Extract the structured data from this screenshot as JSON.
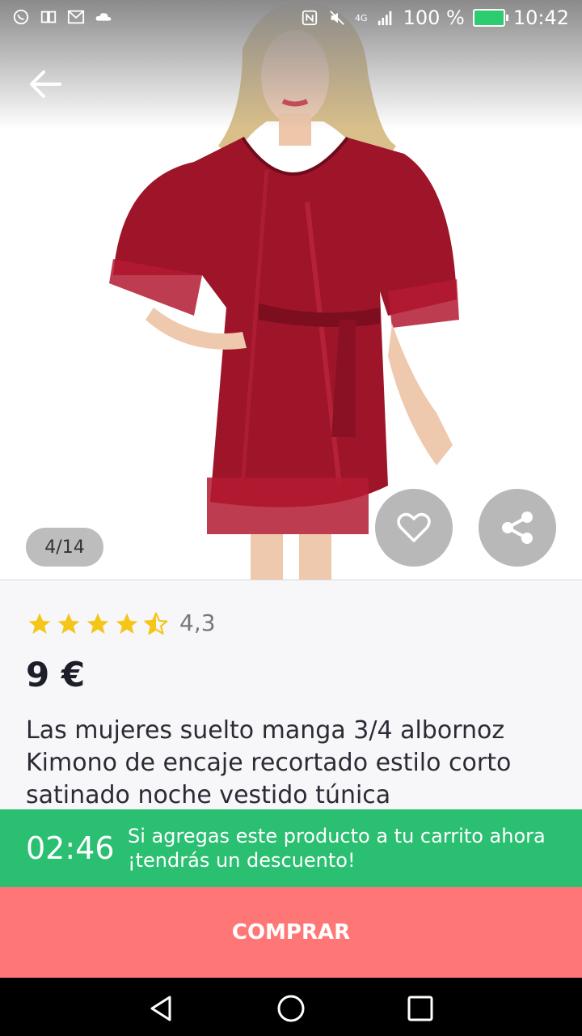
{
  "status_bar": {
    "battery": "100 %",
    "time": "10:42",
    "network": "4G"
  },
  "gallery": {
    "counter": "4/14"
  },
  "product": {
    "rating": "4,3",
    "rating_value": 4.3,
    "price": "9 €",
    "title": "Las mujeres suelto manga 3/4 albornoz Kimono de encaje recortado estilo corto satinado noche vestido túnica"
  },
  "promo": {
    "timer": "02:46",
    "message": "Si agregas este producto a tu carrito ahora ¡tendrás un descuento!"
  },
  "buy_button": {
    "label": "COMPRAR"
  },
  "colors": {
    "promo": "#2bbf72",
    "buy": "#ff7676",
    "star": "#f5c518"
  }
}
